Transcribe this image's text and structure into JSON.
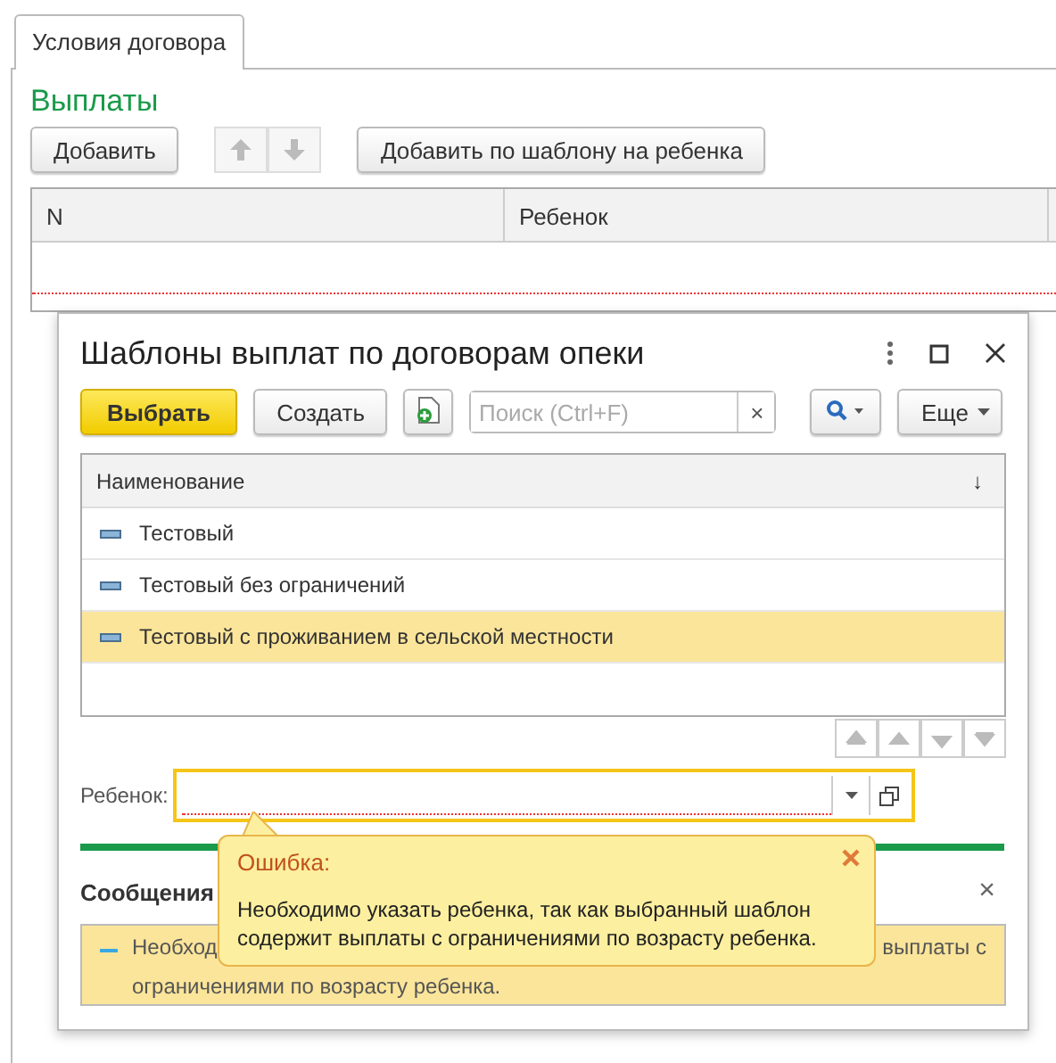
{
  "tabs": [
    {
      "label": "Условия договора",
      "selected": true
    }
  ],
  "section_title": "Выплаты",
  "toolbar": {
    "add_button": "Добавить",
    "add_by_template_button": "Добавить по шаблону на ребенка"
  },
  "table": {
    "columns": [
      "N",
      "Ребенок"
    ]
  },
  "dialog": {
    "title": "Шаблоны выплат по договорам опеки",
    "select_button": "Выбрать",
    "create_button": "Создать",
    "search": {
      "placeholder": "Поиск (Ctrl+F)",
      "clear": "×"
    },
    "more_button": "Еще",
    "list": {
      "column": "Наименование",
      "sort_mark": "↓",
      "rows": [
        {
          "name": "Тестовый",
          "selected": false
        },
        {
          "name": "Тестовый без ограничений",
          "selected": false
        },
        {
          "name": "Тестовый с проживанием в сельской местности",
          "selected": true
        }
      ]
    },
    "child_field": {
      "label": "Ребенок:"
    },
    "messages": {
      "title": "Сообщения",
      "close": "×",
      "message_parts": [
        "Необход",
        "выплаты с",
        "ограничениями по возрасту ребенка."
      ]
    },
    "error_tooltip": {
      "title": "Ошибка:",
      "text": "Необходимо указать ребенка, так как выбранный шаблон содержит выплаты с ограничениями по возрасту ребенка."
    }
  }
}
